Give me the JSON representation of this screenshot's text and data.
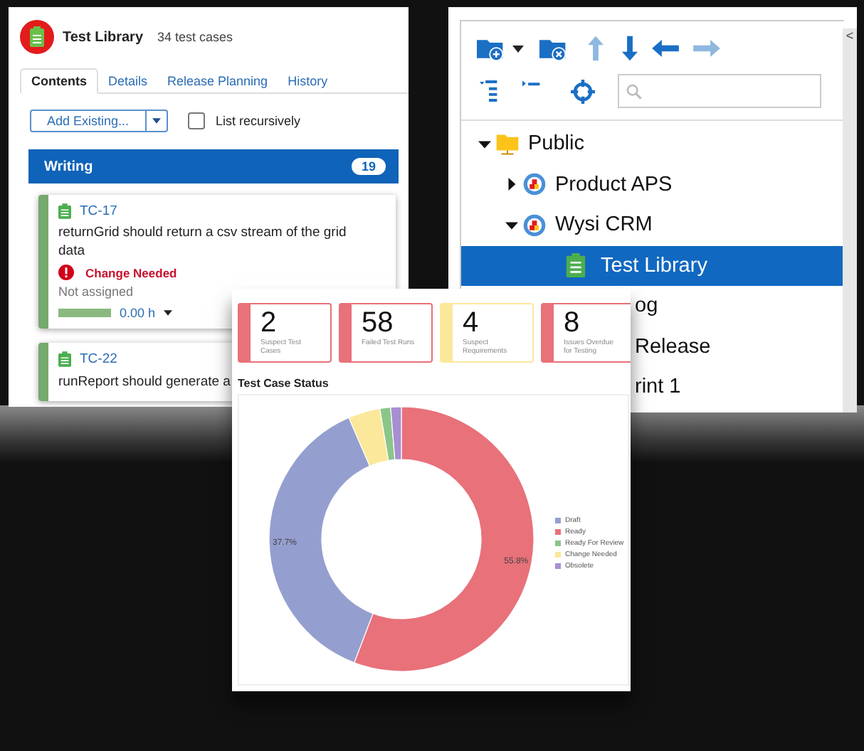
{
  "library_panel": {
    "title": "Test Library",
    "count": "34 test cases",
    "tabs": [
      {
        "label": "Contents",
        "selected": true
      },
      {
        "label": "Details",
        "selected": false
      },
      {
        "label": "Release Planning",
        "selected": false
      },
      {
        "label": "History",
        "selected": false
      }
    ],
    "add_button": "Add Existing...",
    "list_recursively": {
      "label": "List recursively",
      "checked": false
    },
    "group": {
      "title": "Writing",
      "count": "19"
    },
    "cards": [
      {
        "id": "TC-17",
        "description": "returnGrid should return a csv stream of the grid data",
        "status": "Change Needed",
        "owner": "Not assigned",
        "level": 1,
        "hours": "0.00 h"
      },
      {
        "id": "TC-22",
        "description": "runReport should generate a"
      }
    ]
  },
  "tree_panel": {
    "scroll_label": "<",
    "tree": [
      {
        "label": "Public",
        "kind": "folder",
        "expanded": true,
        "selected": false,
        "children": [
          {
            "label": "Product APS",
            "kind": "project",
            "expanded": false,
            "selected": false
          },
          {
            "label": "Wysi CRM",
            "kind": "project",
            "expanded": true,
            "selected": false,
            "children": [
              {
                "label": "Test Library",
                "kind": "library",
                "selected": true
              },
              {
                "label": "og",
                "selected": false
              },
              {
                "label": "Release",
                "selected": false
              },
              {
                "label": "rint 1",
                "selected": false
              }
            ]
          }
        ]
      }
    ]
  },
  "dashboard": {
    "kpis": [
      {
        "value": "2",
        "label": "Suspect Test Cases",
        "color": "#e8717a"
      },
      {
        "value": "58",
        "label": "Failed Test Runs",
        "color": "#e8717a"
      },
      {
        "value": "4",
        "label": "Suspect Requirements",
        "color": "#fbe89a"
      },
      {
        "value": "8",
        "label": "Issues Overdue for Testing",
        "color": "#e8717a"
      }
    ],
    "chart_title": "Test Case Status",
    "chart_data": {
      "type": "donut",
      "categories": [
        "Draft",
        "Ready",
        "Ready For Review",
        "Change Needed",
        "Obsolete"
      ],
      "values": [
        37.7,
        55.8,
        1.3,
        3.9,
        1.3
      ],
      "legend": "right",
      "colors": [
        "#959fcf",
        "#e8717a",
        "#8cc58a",
        "#fbe89a",
        "#a78fd1"
      ],
      "value_labels": [
        "37.7%",
        "55.8%",
        null,
        null,
        null
      ]
    }
  }
}
